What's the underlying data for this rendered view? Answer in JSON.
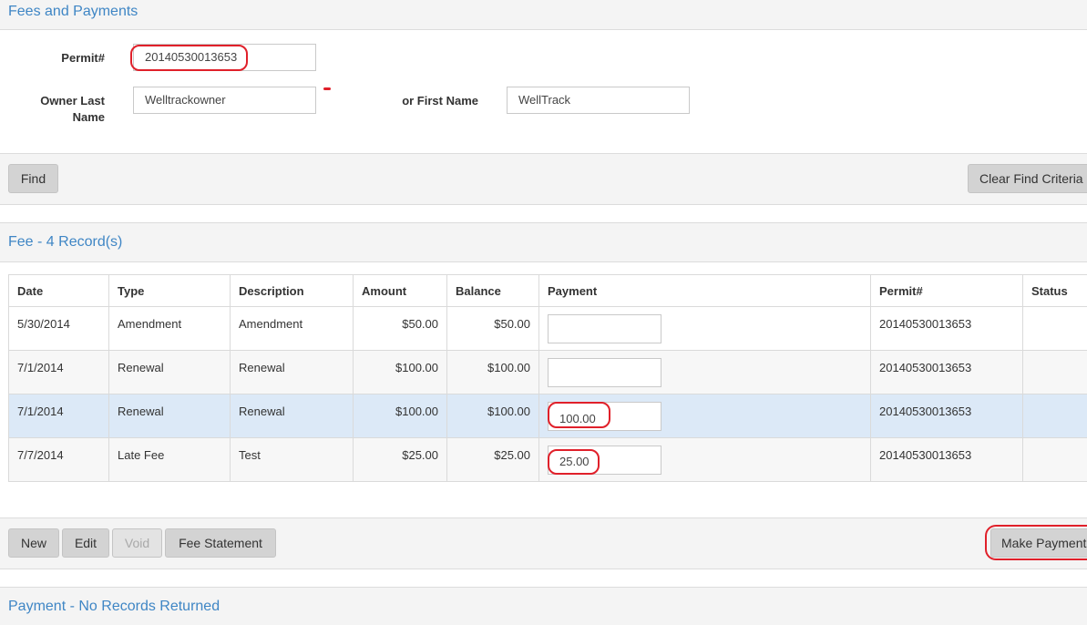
{
  "fees_section": {
    "title": "Fees and Payments"
  },
  "search": {
    "permit_label": "Permit#",
    "permit_value": "20140530013653",
    "owner_last_label": "Owner Last Name",
    "owner_last_value": "Welltrackowner",
    "first_name_label": "or First Name",
    "first_name_value": "WellTrack",
    "find_label": "Find",
    "clear_label": "Clear Find Criteria"
  },
  "fee_grid": {
    "title": "Fee - 4 Record(s)",
    "columns": [
      "Date",
      "Type",
      "Description",
      "Amount",
      "Balance",
      "Payment",
      "Permit#",
      "Status"
    ],
    "rows": [
      {
        "date": "5/30/2014",
        "type": "Amendment",
        "description": "Amendment",
        "amount": "$50.00",
        "balance": "$50.00",
        "payment": "",
        "permit": "20140530013653",
        "status": ""
      },
      {
        "date": "7/1/2014",
        "type": "Renewal",
        "description": "Renewal",
        "amount": "$100.00",
        "balance": "$100.00",
        "payment": "",
        "permit": "20140530013653",
        "status": ""
      },
      {
        "date": "7/1/2014",
        "type": "Renewal",
        "description": "Renewal",
        "amount": "$100.00",
        "balance": "$100.00",
        "payment": "100.00",
        "permit": "20140530013653",
        "status": ""
      },
      {
        "date": "7/7/2014",
        "type": "Late Fee",
        "description": "Test",
        "amount": "$25.00",
        "balance": "$25.00",
        "payment": "25.00",
        "permit": "20140530013653",
        "status": ""
      }
    ]
  },
  "fee_actions": {
    "new": "New",
    "edit": "Edit",
    "void": "Void",
    "fee_statement": "Fee Statement",
    "make_payment": "Make Payment"
  },
  "payment_section": {
    "title": "Payment - No Records Returned"
  },
  "colors": {
    "accent": "#3f86c5",
    "highlight": "#e0202a",
    "selected_row": "#dce9f7"
  }
}
